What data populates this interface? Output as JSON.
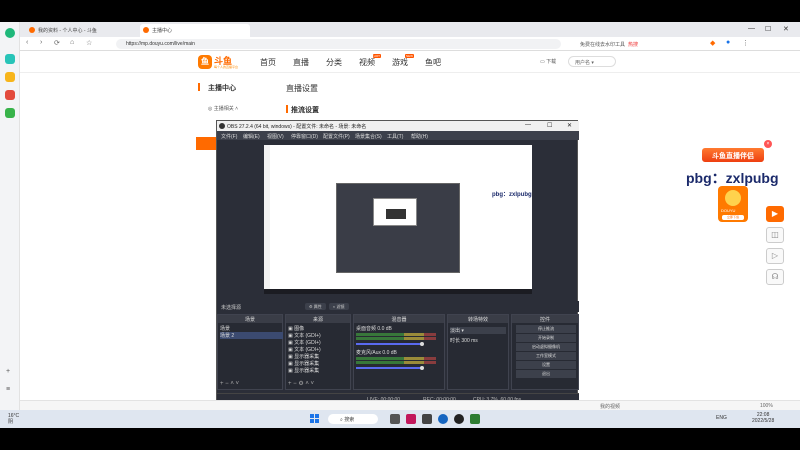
{
  "browser": {
    "tabs": [
      {
        "label": "我的资料 - 个人中心 - 斗鱼",
        "color": "#ff6a00"
      },
      {
        "label": "主播中心",
        "color": "#ff6a00"
      }
    ],
    "url": "https://mp.douyu.com/live/main",
    "search_text": "免费在线去水印工具",
    "search_hot": "热搜"
  },
  "site": {
    "logo_text": "斗鱼",
    "logo_sub": "每个人的直播平台",
    "nav": [
      {
        "label": "首页"
      },
      {
        "label": "直播"
      },
      {
        "label": "分类"
      },
      {
        "label": "视频",
        "tag": "HOT"
      },
      {
        "label": "游戏",
        "tag": "NEW"
      },
      {
        "label": "鱼吧"
      }
    ],
    "download": "下载",
    "user_placeholder": "用户名"
  },
  "sidebar_menu": {
    "title": "主播中心",
    "sub_item": "主播相关"
  },
  "content": {
    "title": "直播设置",
    "section": "推流设置"
  },
  "obs": {
    "title": "OBS 27.2.4 (64 bit, windows) - 配置文件: 未命名 - 场景: 未命名",
    "menus": [
      "文件(F)",
      "编辑(E)",
      "视图(V)",
      "停靠窗口(D)",
      "配置文件(P)",
      "场景集合(S)",
      "工具(T)",
      "帮助(H)"
    ],
    "source_bar": {
      "label": "未选择源",
      "props": "属性",
      "filters": "滤镜"
    },
    "docks": {
      "scenes": {
        "header": "场景",
        "items": [
          "场景",
          "场景 2"
        ]
      },
      "sources": {
        "header": "来源",
        "items": [
          "图像",
          "文本 (GDI+)",
          "文本 (GDI+)",
          "文本 (GDI+)",
          "显示器采集",
          "显示器采集",
          "显示器采集"
        ]
      },
      "mixer": {
        "header": "混音器",
        "channels": [
          {
            "name": "桌面音频",
            "db": "0.0 dB"
          },
          {
            "name": "麦克风/Aux",
            "db": "0.0 dB"
          }
        ]
      },
      "transitions": {
        "header": "转场特效",
        "type": "淡出",
        "duration_label": "时长",
        "duration_value": "300 ms"
      },
      "controls": {
        "header": "控件",
        "buttons": [
          "停止推流",
          "开始录制",
          "启动虚拟摄像机",
          "工作室模式",
          "设置",
          "退出"
        ]
      }
    },
    "status": {
      "live": "LIVE: 00:00:00",
      "rec": "REC: 00:00:00",
      "cpu": "CPU: 3.7%, 60.00 fps"
    }
  },
  "ad": {
    "banner": "斗鱼直播伴侣",
    "watermark": "pbg：zxlpubg",
    "card_label": "DOUYU",
    "card_button": "立即下载"
  },
  "right_tools": [
    "play",
    "shot",
    "live",
    "support"
  ],
  "statusbar": {
    "left": "",
    "right1": "我的视频",
    "zoom": "100%"
  },
  "taskbar": {
    "weather_temp": "16°C",
    "weather_desc": "阴",
    "search_label": "搜索",
    "lang": "ENG",
    "time": "22:08",
    "date": "2022/5/28"
  }
}
